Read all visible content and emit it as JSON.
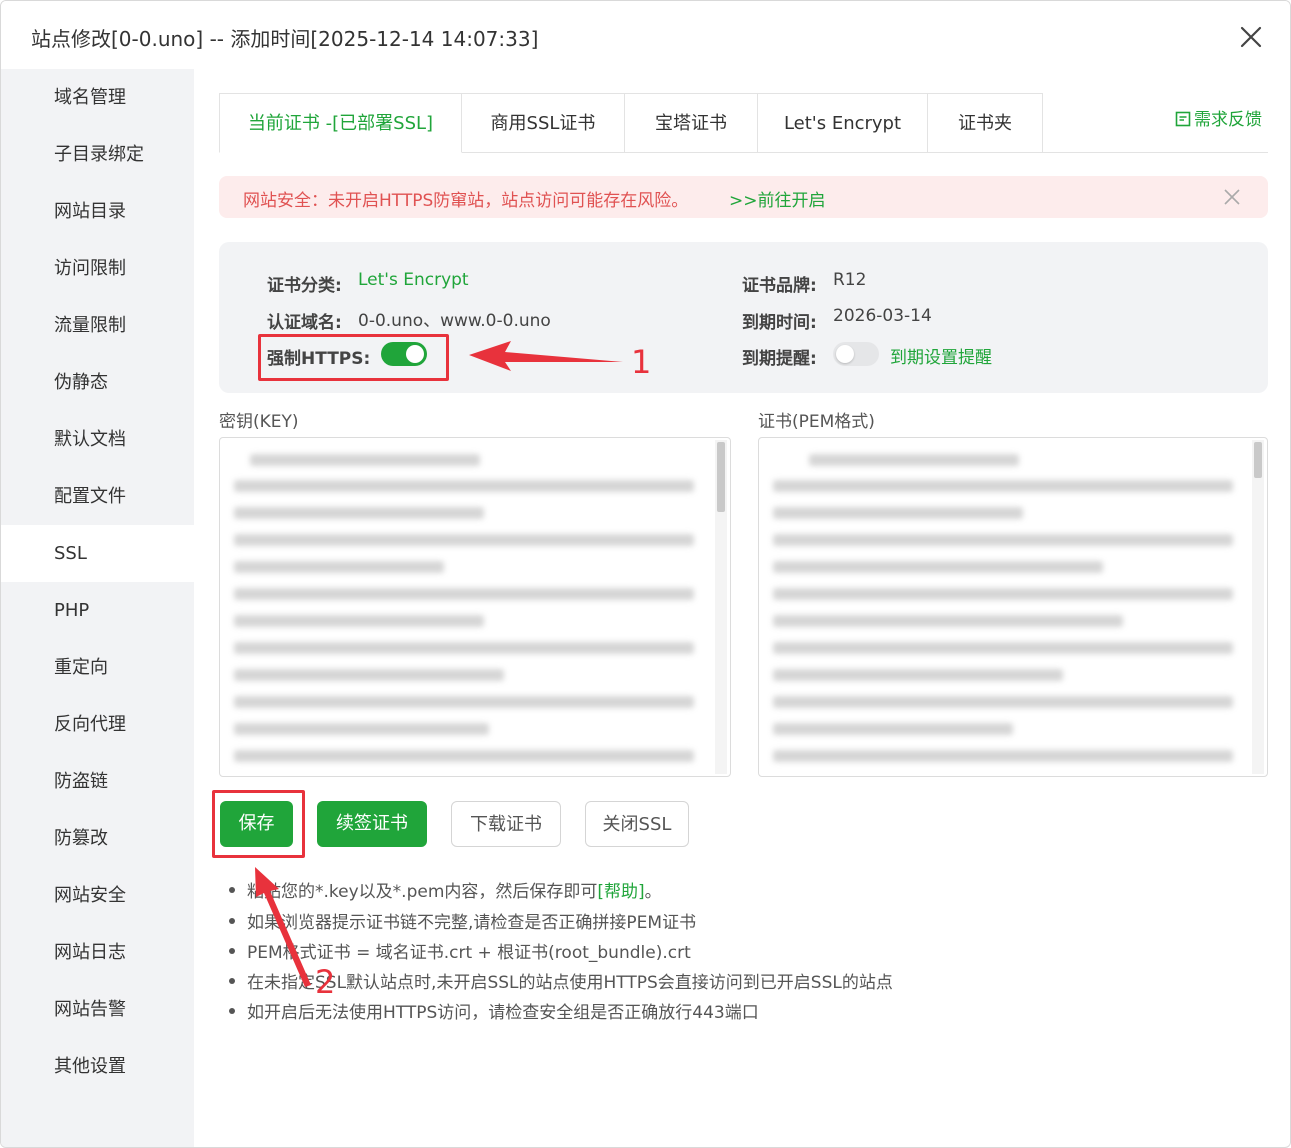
{
  "window": {
    "title": "站点修改[0-0.uno] -- 添加时间[2025-12-14 14:07:33]"
  },
  "sidebar": {
    "items": [
      {
        "label": "域名管理"
      },
      {
        "label": "子目录绑定"
      },
      {
        "label": "网站目录"
      },
      {
        "label": "访问限制"
      },
      {
        "label": "流量限制"
      },
      {
        "label": "伪静态"
      },
      {
        "label": "默认文档"
      },
      {
        "label": "配置文件"
      },
      {
        "label": "SSL",
        "active": true
      },
      {
        "label": "PHP"
      },
      {
        "label": "重定向"
      },
      {
        "label": "反向代理"
      },
      {
        "label": "防盗链"
      },
      {
        "label": "防篡改"
      },
      {
        "label": "网站安全"
      },
      {
        "label": "网站日志"
      },
      {
        "label": "网站告警"
      },
      {
        "label": "其他设置"
      }
    ]
  },
  "tabs": [
    {
      "label": "当前证书 -[已部署SSL]",
      "active": true
    },
    {
      "label": "商用SSL证书"
    },
    {
      "label": "宝塔证书"
    },
    {
      "label": "Let's Encrypt"
    },
    {
      "label": "证书夹"
    }
  ],
  "feedback": {
    "label": "需求反馈"
  },
  "alert": {
    "text": "网站安全：未开启HTTPS防窜站，站点访问可能存在风险。",
    "link": ">>前往开启"
  },
  "cert_info": {
    "category_label": "证书分类:",
    "category_value": "Let's Encrypt",
    "domain_label": "认证域名:",
    "domain_value": "0-0.uno、www.0-0.uno",
    "force_https_label": "强制HTTPS:",
    "force_https_on": true,
    "brand_label": "证书品牌:",
    "brand_value": "R12",
    "expire_label": "到期时间:",
    "expire_value": "2026-03-14",
    "reminder_label": "到期提醒:",
    "reminder_on": false,
    "reminder_link": "到期设置提醒"
  },
  "annotations": {
    "marker_1": "1",
    "marker_2": "2",
    "color": "#e8323c"
  },
  "key_field": {
    "label": "密钥(KEY)"
  },
  "cert_field": {
    "label": "证书(PEM格式)"
  },
  "buttons": {
    "save": "保存",
    "renew": "续签证书",
    "download": "下载证书",
    "close_ssl": "关闭SSL"
  },
  "tips": {
    "tip1_text": "粘贴您的*.key以及*.pem内容，然后保存即可",
    "tip1_help": "[帮助]",
    "tip1_end": "。",
    "tip2": "如果浏览器提示证书链不完整,请检查是否正确拼接PEM证书",
    "tip3": "PEM格式证书 = 域名证书.crt + 根证书(root_bundle).crt",
    "tip4": "在未指定SSL默认站点时,未开启SSL的站点使用HTTPS会直接访问到已开启SSL的站点",
    "tip5": "如开启后无法使用HTTPS访问，请检查安全组是否正确放行443端口"
  },
  "colors": {
    "accent": "#20a53a",
    "danger": "#e05252",
    "alert_bg": "#fdecec"
  }
}
